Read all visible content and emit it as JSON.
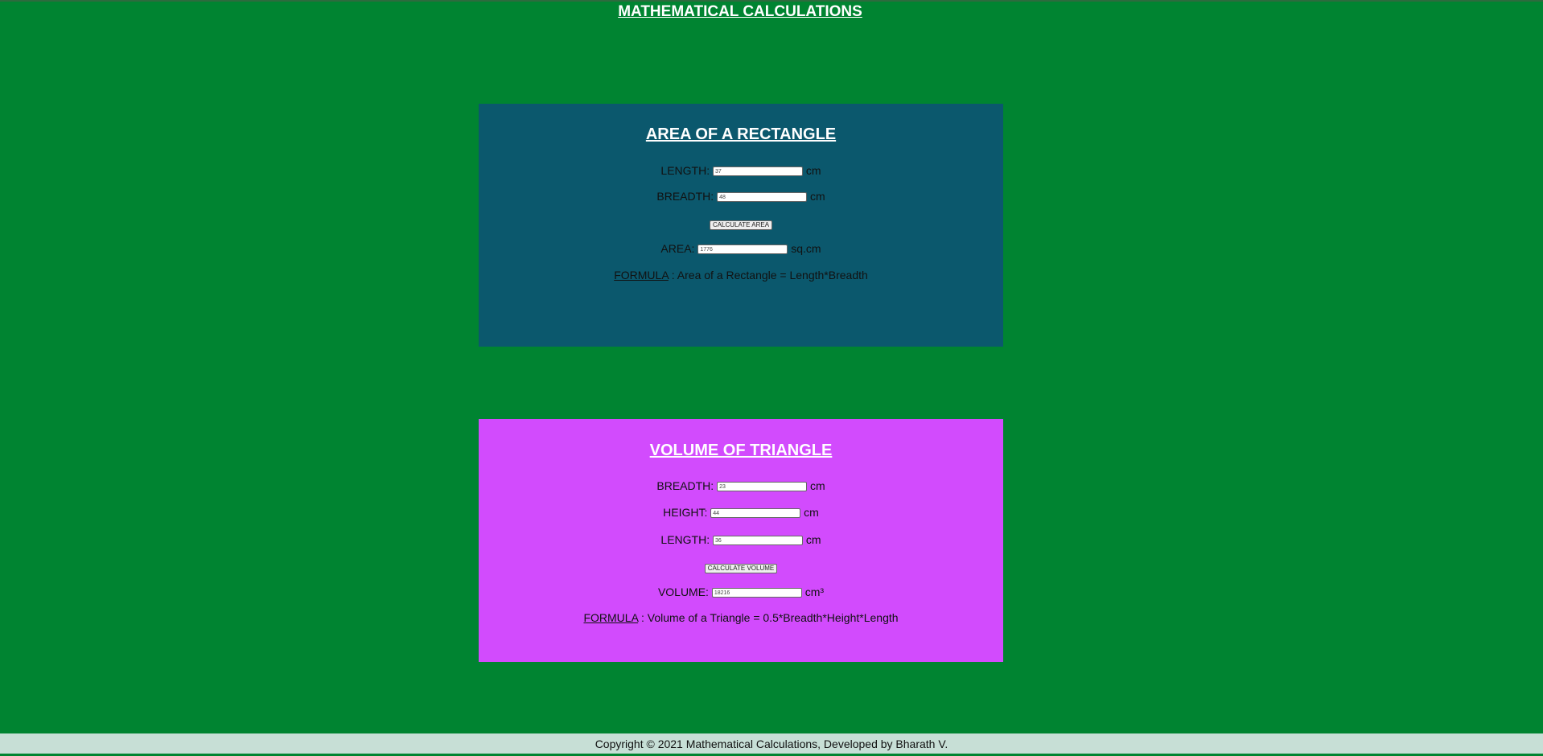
{
  "page": {
    "title": "MATHEMATICAL CALCULATIONS"
  },
  "rectangle": {
    "heading": "AREA OF A RECTANGLE",
    "length_label": "LENGTH:",
    "length_value": "37",
    "length_unit": "cm",
    "breadth_label": "BREADTH:",
    "breadth_value": "48",
    "breadth_unit": "cm",
    "button_label": "CALCULATE AREA",
    "area_label": "AREA:",
    "area_value": "1776",
    "area_unit": "sq.cm",
    "formula_label": "FORMULA",
    "formula_text": " : Area of a Rectangle = Length*Breadth"
  },
  "volume": {
    "heading": "VOLUME OF TRIANGLE",
    "breadth_label": "BREADTH:",
    "breadth_value": "23",
    "breadth_unit": "cm",
    "height_label": "HEIGHT:",
    "height_value": "44",
    "height_unit": "cm",
    "length_label": "LENGTH:",
    "length_value": "36",
    "length_unit": "cm",
    "button_label": "CALCULATE VOLUME",
    "volume_label": "VOLUME:",
    "volume_value": "18216",
    "volume_unit": "cm³",
    "formula_label": "FORMULA",
    "formula_text": " : Volume of a Triangle = 0.5*Breadth*Height*Length"
  },
  "footer": {
    "text": "Copyright © 2021 Mathematical Calculations, Developed by Bharath V."
  },
  "colors": {
    "page_background": "#008431",
    "rectangle_card": "#0b586d",
    "volume_card": "#d24bfd",
    "footer_background": "#c7dfd6"
  }
}
